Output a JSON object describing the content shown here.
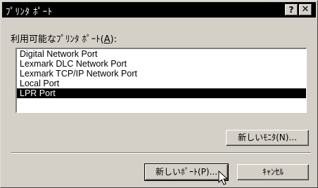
{
  "window": {
    "title": "ﾌﾟﾘﾝﾀ ﾎﾟｰﾄ",
    "help_label": "?",
    "close_label": "✕"
  },
  "ports": {
    "label_prefix": "利用可能なﾌﾟﾘﾝﾀ ﾎﾟｰﾄ(",
    "label_accel": "A",
    "label_suffix": "):",
    "items": [
      {
        "label": "Digital Network Port",
        "selected": false
      },
      {
        "label": "Lexmark DLC Network Port",
        "selected": false
      },
      {
        "label": "Lexmark TCP/IP Network Port",
        "selected": false
      },
      {
        "label": "Local Port",
        "selected": false
      },
      {
        "label": "LPR Port",
        "selected": true
      }
    ]
  },
  "buttons": {
    "new_monitor": "新しいﾓﾆﾀ(N)...",
    "new_port": "新しいﾎﾟｰﾄ(P)...",
    "cancel": "ｷｬﾝｾﾙ"
  },
  "icons": {
    "cursor": "arrow-cursor-icon"
  }
}
